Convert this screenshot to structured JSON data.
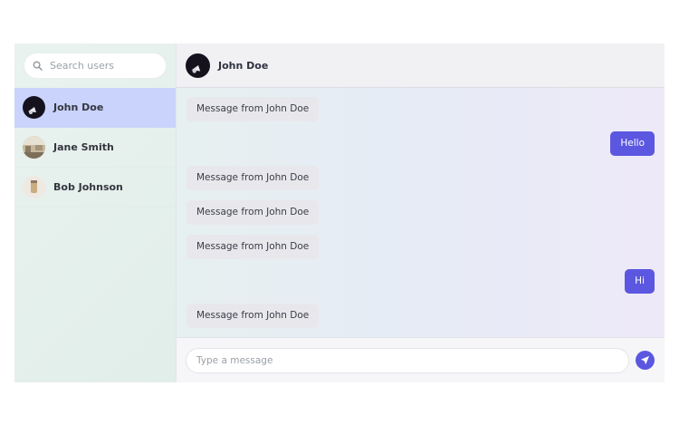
{
  "sidebar": {
    "search": {
      "placeholder": "Search users",
      "icon": "search-icon"
    },
    "users": [
      {
        "name": "John Doe",
        "active": true,
        "avatar": "avatar-dark"
      },
      {
        "name": "Jane Smith",
        "active": false,
        "avatar": "avatar-room"
      },
      {
        "name": "Bob Johnson",
        "active": false,
        "avatar": "avatar-jar"
      }
    ]
  },
  "chat": {
    "header": {
      "name": "John Doe"
    },
    "messages": [
      {
        "direction": "in",
        "text": "Message from John Doe"
      },
      {
        "direction": "out",
        "text": "Hello"
      },
      {
        "direction": "in",
        "text": "Message from John Doe"
      },
      {
        "direction": "in",
        "text": "Message from John Doe"
      },
      {
        "direction": "in",
        "text": "Message from John Doe"
      },
      {
        "direction": "out",
        "text": "Hi"
      },
      {
        "direction": "in",
        "text": "Message from John Doe"
      }
    ],
    "composer": {
      "placeholder": "Type a message",
      "send_icon": "send-icon"
    }
  },
  "colors": {
    "accent": "#5b57e0",
    "active_user_bg": "#c9d3fb",
    "incoming_bubble": "#e8e8ec"
  }
}
